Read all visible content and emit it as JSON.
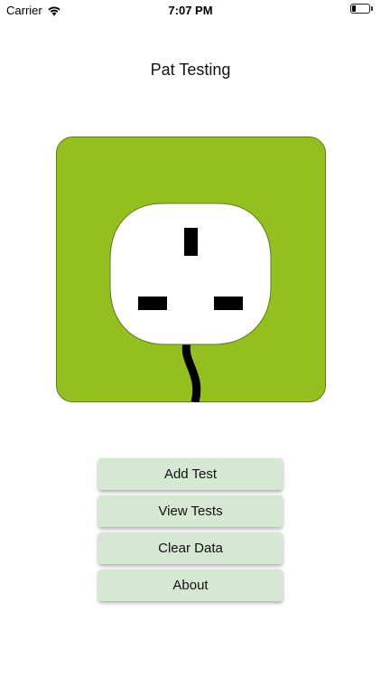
{
  "status_bar": {
    "carrier": "Carrier",
    "time": "7:07 PM",
    "battery_level": 0.2,
    "wifi_icon": "wifi-icon",
    "battery_icon": "battery-icon"
  },
  "header": {
    "title": "Pat Testing"
  },
  "hero": {
    "icon": "uk-plug-socket-icon",
    "background_color": "#93c01f",
    "plug_color": "#ffffff",
    "pin_color": "#000000"
  },
  "menu": {
    "add_test": "Add Test",
    "view_tests": "View Tests",
    "clear_data": "Clear Data",
    "about": "About",
    "button_color": "#d5e8d1"
  }
}
